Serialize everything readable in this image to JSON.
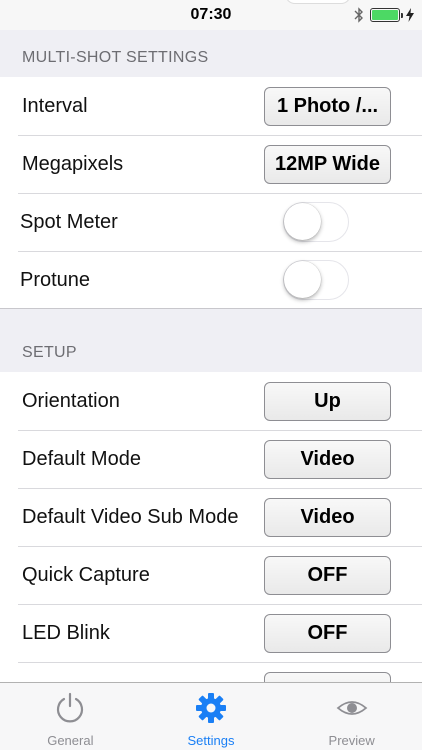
{
  "status_bar": {
    "time": "07:30"
  },
  "sections": {
    "multishot": {
      "header": "MULTI-SHOT SETTINGS",
      "rows": {
        "interval": {
          "label": "Interval",
          "value": "1 Photo /..."
        },
        "megapixels": {
          "label": "Megapixels",
          "value": "12MP Wide"
        },
        "spot_meter": {
          "label": "Spot Meter",
          "on": false
        },
        "protune": {
          "label": "Protune",
          "on": false
        }
      }
    },
    "setup": {
      "header": "SETUP",
      "rows": {
        "orientation": {
          "label": "Orientation",
          "value": "Up"
        },
        "default_mode": {
          "label": "Default Mode",
          "value": "Video"
        },
        "default_video_sub_mode": {
          "label": "Default Video Sub Mode",
          "value": "Video"
        },
        "quick_capture": {
          "label": "Quick Capture",
          "value": "OFF"
        },
        "led_blink": {
          "label": "LED Blink",
          "value": "OFF"
        }
      }
    }
  },
  "tab_bar": {
    "general": "General",
    "settings": "Settings",
    "preview": "Preview"
  },
  "colors": {
    "accent": "#1a7ff5",
    "battery": "#4cd964",
    "header_text": "#6d6d72"
  },
  "icons": {
    "general": "power-icon",
    "settings": "gear-icon",
    "preview": "eye-icon"
  }
}
